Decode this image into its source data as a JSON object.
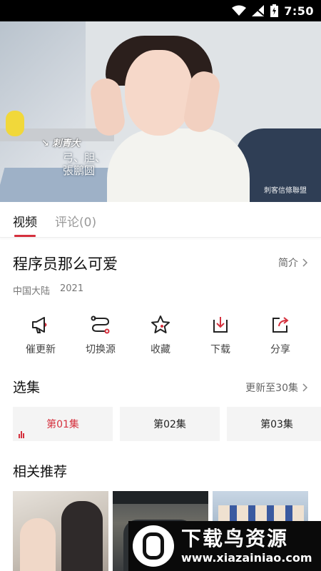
{
  "status_bar": {
    "time": "7:50"
  },
  "video": {
    "caption_name": "↘ 刺青大",
    "caption_line1": "弓、胆、",
    "caption_line2": "張鵬圆",
    "watermark": "刺客信條聯盟"
  },
  "tabs": [
    {
      "label": "视频",
      "active": true
    },
    {
      "label": "评论(0)",
      "active": false
    }
  ],
  "show": {
    "title": "程序员那么可爱",
    "intro_label": "简介",
    "region": "中国大陆",
    "year": "2021"
  },
  "actions": [
    {
      "label": "催更新",
      "icon": "megaphone-icon"
    },
    {
      "label": "切换源",
      "icon": "switch-source-icon"
    },
    {
      "label": "收藏",
      "icon": "star-icon"
    },
    {
      "label": "下载",
      "icon": "download-icon"
    },
    {
      "label": "分享",
      "icon": "share-icon"
    }
  ],
  "episodes": {
    "section_title": "选集",
    "update_status": "更新至30集",
    "items": [
      {
        "label": "第01集",
        "active": true
      },
      {
        "label": "第02集",
        "active": false
      },
      {
        "label": "第03集",
        "active": false
      }
    ]
  },
  "recommendations": {
    "section_title": "相关推荐"
  },
  "banner": {
    "title": "下载鸟资源",
    "url": "www.xiazainiao.com"
  },
  "colors": {
    "accent": "#d5303d",
    "status_bar_bg": "#000000",
    "episode_bg": "#f4f4f4"
  }
}
